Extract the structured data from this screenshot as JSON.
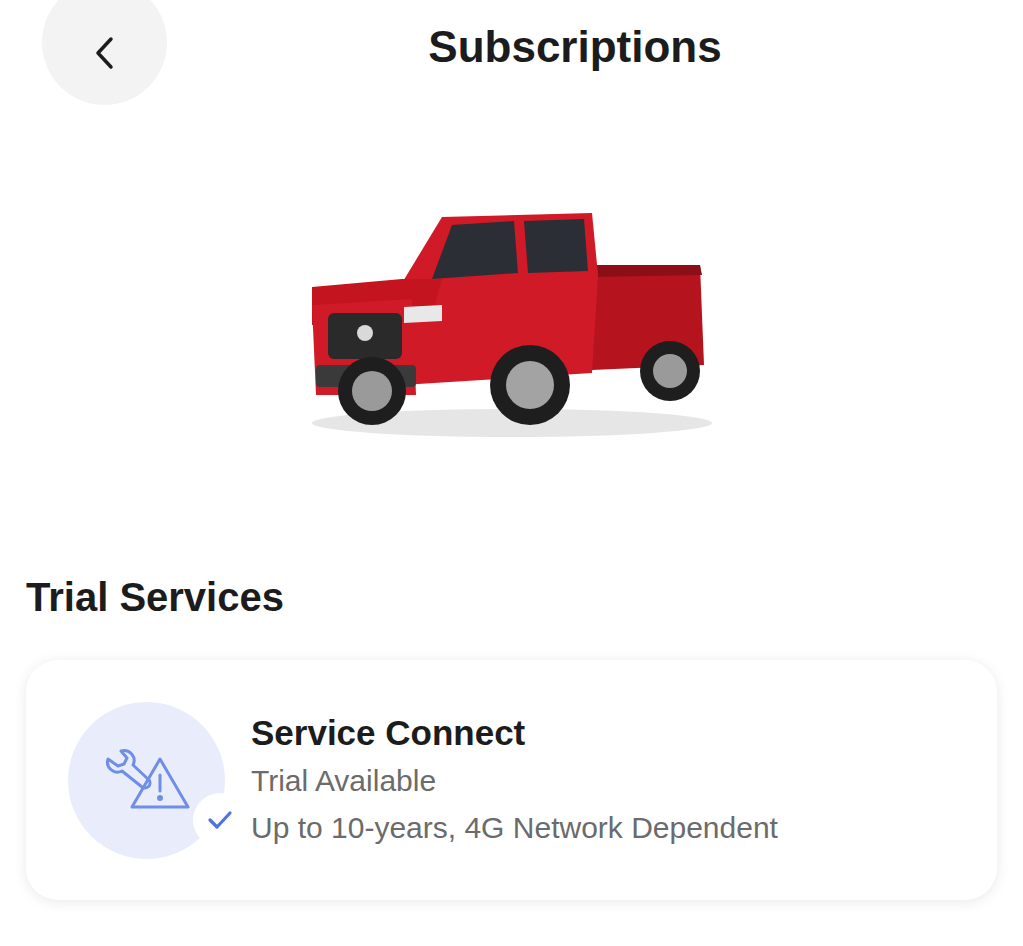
{
  "header": {
    "title": "Subscriptions"
  },
  "section": {
    "title": "Trial Services"
  },
  "services": [
    {
      "name": "Service Connect",
      "status": "Trial Available",
      "detail": "Up to 10-years, 4G Network Dependent",
      "checked": true
    }
  ]
}
